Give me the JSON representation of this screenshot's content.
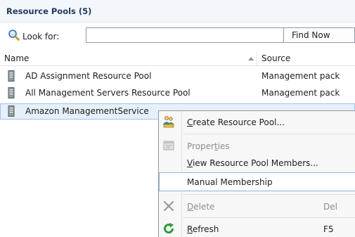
{
  "pane": {
    "title": "Resource Pools (5)"
  },
  "search": {
    "label": "Look for:",
    "value": "",
    "find_button": "Find Now"
  },
  "columns": {
    "name": "Name",
    "source": "Source"
  },
  "rows": [
    {
      "name": "AD Assignment Resource Pool",
      "source": "Management pack"
    },
    {
      "name": "All Management Servers Resource Pool",
      "source": "Management pack"
    },
    {
      "name": "Amazon ManagementService",
      "source": ""
    }
  ],
  "context_menu": {
    "items": [
      {
        "pre": "",
        "key": "C",
        "post": "reate Resource Pool...",
        "shortcut": "",
        "icon": "create-pool-icon",
        "enabled": true
      },
      {
        "pre": "Proper",
        "key": "t",
        "post": "ies",
        "shortcut": "",
        "icon": "properties-icon",
        "enabled": false
      },
      {
        "pre": "",
        "key": "V",
        "post": "iew Resource Pool Members...",
        "shortcut": "",
        "icon": "",
        "enabled": true
      },
      {
        "pre": "Manual Membership",
        "key": "",
        "post": "",
        "shortcut": "",
        "icon": "",
        "enabled": true
      },
      {
        "pre": "",
        "key": "D",
        "post": "elete",
        "shortcut": "Del",
        "icon": "delete-icon",
        "enabled": false
      },
      {
        "pre": "",
        "key": "R",
        "post": "efresh",
        "shortcut": "F5",
        "icon": "refresh-icon",
        "enabled": true
      }
    ]
  }
}
